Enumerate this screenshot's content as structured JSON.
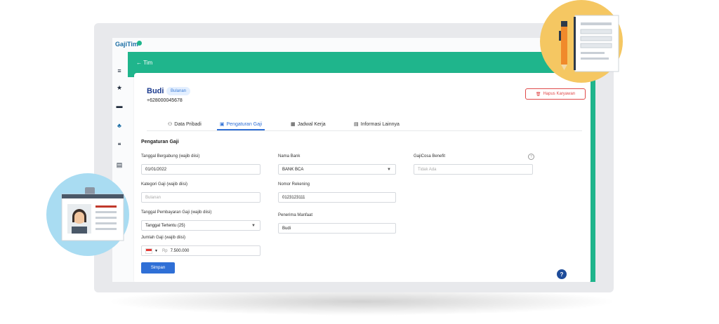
{
  "app": {
    "logo": "GajiTim"
  },
  "header": {
    "back_label": "Tim"
  },
  "employee": {
    "name": "Budi",
    "badge": "Bulanan",
    "phone": "+628000045678"
  },
  "actions": {
    "delete_label": "Hapus Karyawan",
    "save_label": "Simpan"
  },
  "tabs": [
    {
      "label": "Data Pribadi"
    },
    {
      "label": "Pengaturan Gaji"
    },
    {
      "label": "Jadwal Kerja"
    },
    {
      "label": "Informasi Lainnya"
    }
  ],
  "section_title": "Pengaturan Gaji",
  "form": {
    "join_date": {
      "label": "Tanggal Bergabung (wajib diisi)",
      "value": "01/01/2022"
    },
    "salary_category": {
      "label": "Kategori Gaji (wajib diisi)",
      "placeholder": "Bulanan"
    },
    "pay_date": {
      "label": "Tanggal Pembayaran Gaji (wajib diisi)",
      "value": "Tanggal Tertentu (25)"
    },
    "salary_amount": {
      "label": "Jumlah Gaji (wajib diisi)",
      "currency": "Rp",
      "value": "7.500.000"
    },
    "bank_name": {
      "label": "Nama Bank",
      "value": "BANK BCA"
    },
    "account_number": {
      "label": "Nomor Rekening",
      "value": "0123123111"
    },
    "beneficiary": {
      "label": "Penerima Manfaat",
      "value": "Budi"
    },
    "gajicosa": {
      "label": "GajiCosa Benefit",
      "placeholder": "Tidak Ada"
    }
  },
  "colors": {
    "primary": "#2f6fd6",
    "brand_green": "#1fb58c",
    "danger": "#e04a4a"
  }
}
